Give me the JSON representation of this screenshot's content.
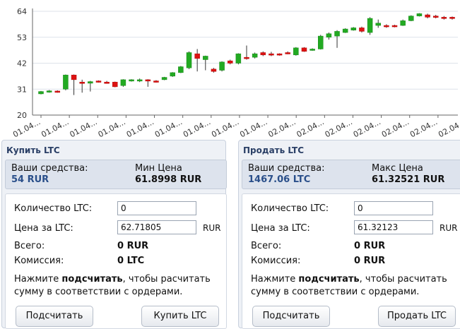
{
  "chart_data": {
    "type": "candlestick",
    "y_ticks": [
      "64",
      "53",
      "42",
      "31",
      "20"
    ],
    "ylim": [
      20,
      64
    ],
    "x_tick_labels": [
      "01.04...",
      "01.04...",
      "01.04...",
      "01.04...",
      "01.04...",
      "01.04...",
      "01.04...",
      "01.04...",
      "01.04...",
      "02.04...",
      "02.04...",
      "02.04...",
      "02.04...",
      "02.04...",
      "02.04...",
      "02.04..."
    ],
    "candles": [
      {
        "o": 29.0,
        "c": 30.0,
        "h": 30.2,
        "l": 28.8,
        "up": true
      },
      {
        "o": 29.8,
        "c": 30.3,
        "h": 30.6,
        "l": 29.5,
        "up": true
      },
      {
        "o": 29.8,
        "c": 30.2,
        "h": 30.5,
        "l": 29.5,
        "up": false
      },
      {
        "o": 31.0,
        "c": 37.0,
        "h": 37.2,
        "l": 30.5,
        "up": true
      },
      {
        "o": 37.0,
        "c": 35.0,
        "h": 37.2,
        "l": 28.5,
        "up": false
      },
      {
        "o": 34.0,
        "c": 33.5,
        "h": 35.0,
        "l": 29.5,
        "up": false
      },
      {
        "o": 33.5,
        "c": 34.2,
        "h": 34.5,
        "l": 30.0,
        "up": true
      },
      {
        "o": 34.0,
        "c": 34.5,
        "h": 34.7,
        "l": 33.8,
        "up": false
      },
      {
        "o": 34.0,
        "c": 33.5,
        "h": 34.5,
        "l": 33.3,
        "up": false
      },
      {
        "o": 32.0,
        "c": 34.0,
        "h": 34.2,
        "l": 31.8,
        "up": false
      },
      {
        "o": 32.5,
        "c": 35.0,
        "h": 35.2,
        "l": 32.0,
        "up": true
      },
      {
        "o": 34.5,
        "c": 35.0,
        "h": 35.2,
        "l": 34.2,
        "up": true
      },
      {
        "o": 35.0,
        "c": 34.5,
        "h": 35.5,
        "l": 34.0,
        "up": true
      },
      {
        "o": 34.5,
        "c": 35.0,
        "h": 35.2,
        "l": 32.0,
        "up": false
      },
      {
        "o": 34.5,
        "c": 34.0,
        "h": 34.8,
        "l": 33.8,
        "up": false
      },
      {
        "o": 35.0,
        "c": 36.0,
        "h": 36.2,
        "l": 34.8,
        "up": true
      },
      {
        "o": 36.5,
        "c": 38.0,
        "h": 38.2,
        "l": 36.2,
        "up": true
      },
      {
        "o": 38.0,
        "c": 40.5,
        "h": 40.8,
        "l": 37.8,
        "up": true
      },
      {
        "o": 40.0,
        "c": 46.5,
        "h": 47.0,
        "l": 39.5,
        "up": true
      },
      {
        "o": 46.0,
        "c": 44.0,
        "h": 48.0,
        "l": 38.5,
        "up": false
      },
      {
        "o": 43.5,
        "c": 45.0,
        "h": 45.2,
        "l": 39.0,
        "up": true
      },
      {
        "o": 39.5,
        "c": 38.5,
        "h": 40.0,
        "l": 38.0,
        "up": false
      },
      {
        "o": 39.0,
        "c": 42.5,
        "h": 42.8,
        "l": 38.5,
        "up": true
      },
      {
        "o": 43.0,
        "c": 42.0,
        "h": 43.5,
        "l": 41.5,
        "up": false
      },
      {
        "o": 42.0,
        "c": 46.0,
        "h": 46.2,
        "l": 41.5,
        "up": true
      },
      {
        "o": 44.0,
        "c": 44.5,
        "h": 49.5,
        "l": 43.5,
        "up": false
      },
      {
        "o": 44.5,
        "c": 46.0,
        "h": 46.5,
        "l": 44.0,
        "up": true
      },
      {
        "o": 45.5,
        "c": 46.5,
        "h": 47.0,
        "l": 45.0,
        "up": false
      },
      {
        "o": 46.0,
        "c": 45.5,
        "h": 46.8,
        "l": 45.0,
        "up": false
      },
      {
        "o": 45.5,
        "c": 46.0,
        "h": 46.2,
        "l": 45.2,
        "up": false
      },
      {
        "o": 46.0,
        "c": 46.5,
        "h": 47.0,
        "l": 45.8,
        "up": false
      },
      {
        "o": 45.5,
        "c": 48.5,
        "h": 48.8,
        "l": 45.2,
        "up": true
      },
      {
        "o": 47.0,
        "c": 48.5,
        "h": 48.8,
        "l": 46.8,
        "up": false
      },
      {
        "o": 47.5,
        "c": 48.0,
        "h": 48.3,
        "l": 47.3,
        "up": true
      },
      {
        "o": 48.0,
        "c": 53.5,
        "h": 54.0,
        "l": 47.8,
        "up": true
      },
      {
        "o": 53.0,
        "c": 54.5,
        "h": 55.0,
        "l": 52.0,
        "up": true
      },
      {
        "o": 53.5,
        "c": 55.5,
        "h": 56.0,
        "l": 48.5,
        "up": true
      },
      {
        "o": 55.0,
        "c": 56.5,
        "h": 56.8,
        "l": 54.8,
        "up": true
      },
      {
        "o": 56.0,
        "c": 57.0,
        "h": 57.3,
        "l": 55.8,
        "up": true
      },
      {
        "o": 57.0,
        "c": 55.5,
        "h": 57.5,
        "l": 55.0,
        "up": false
      },
      {
        "o": 55.0,
        "c": 61.0,
        "h": 61.5,
        "l": 54.0,
        "up": true
      },
      {
        "o": 59.0,
        "c": 58.0,
        "h": 60.5,
        "l": 57.0,
        "up": true
      },
      {
        "o": 58.0,
        "c": 57.5,
        "h": 58.5,
        "l": 57.0,
        "up": false
      },
      {
        "o": 57.5,
        "c": 58.0,
        "h": 58.3,
        "l": 57.2,
        "up": false
      },
      {
        "o": 58.0,
        "c": 60.0,
        "h": 60.5,
        "l": 57.8,
        "up": true
      },
      {
        "o": 60.0,
        "c": 62.0,
        "h": 62.3,
        "l": 59.8,
        "up": true
      },
      {
        "o": 62.0,
        "c": 63.0,
        "h": 63.2,
        "l": 61.8,
        "up": true
      },
      {
        "o": 62.5,
        "c": 61.5,
        "h": 63.0,
        "l": 61.0,
        "up": false
      },
      {
        "o": 61.5,
        "c": 62.0,
        "h": 62.5,
        "l": 61.0,
        "up": false
      },
      {
        "o": 61.5,
        "c": 61.0,
        "h": 62.0,
        "l": 60.5,
        "up": false
      },
      {
        "o": 61.0,
        "c": 61.5,
        "h": 61.8,
        "l": 60.5,
        "up": false
      }
    ]
  },
  "colors": {
    "up": "#22aa22",
    "down": "#dd1111",
    "wick": "#333333",
    "grid": "#dde2ea",
    "axis": "#666666"
  },
  "buy": {
    "title": "Купить LTC",
    "funds_label": "Ваши средства:",
    "funds_value": "54 RUR",
    "price_label": "Мин Цена",
    "price_value": "61.8998 RUR",
    "qty_label": "Количество LTC:",
    "qty_value": "0",
    "price_per_label": "Цена за LTC:",
    "price_per_value": "62.71805",
    "price_unit": "RUR",
    "total_label": "Всего:",
    "total_value": "0 RUR",
    "fee_label": "Комиссия:",
    "fee_value": "0 LTC",
    "note_before": "Нажмите ",
    "note_bold": "подсчитать",
    "note_after": ", чтобы расчитать сумму в соответствии с ордерами.",
    "calc_button": "Подсчитать",
    "action_button": "Купить LTC"
  },
  "sell": {
    "title": "Продать LTC",
    "funds_label": "Ваши средства:",
    "funds_value": "1467.06 LTC",
    "price_label": "Макс Цена",
    "price_value": "61.32521 RUR",
    "qty_label": "Количество LTC:",
    "qty_value": "0",
    "price_per_label": "Цена за LTC:",
    "price_per_value": "61.32123",
    "price_unit": "RUR",
    "total_label": "Всего:",
    "total_value": "0 RUR",
    "fee_label": "Комиссия:",
    "fee_value": "0 RUR",
    "note_before": "Нажмите ",
    "note_bold": "подсчитать",
    "note_after": ", чтобы расчитать сумму в соответствии с ордерами.",
    "calc_button": "Подсчитать",
    "action_button": "Продать LTC"
  }
}
